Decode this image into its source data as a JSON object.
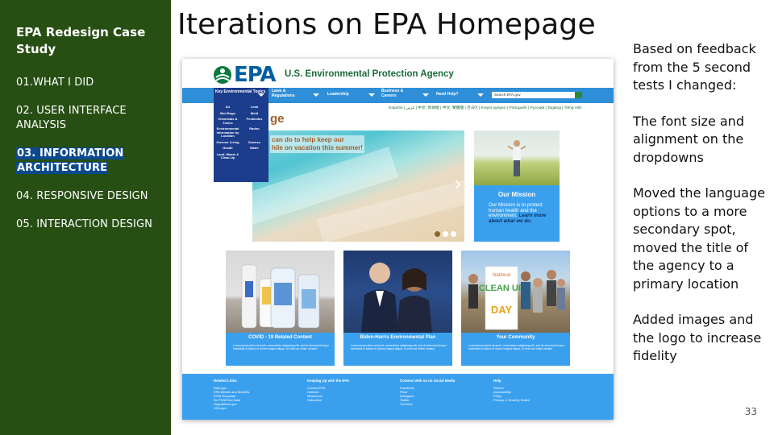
{
  "sidebar": {
    "title": "EPA Redesign Case Study",
    "items": [
      {
        "label": "01.WHAT I DID"
      },
      {
        "label": "02. USER INTERFACE ANALYSIS"
      },
      {
        "label": "03. INFORMATION ARCHITECTURE"
      },
      {
        "label": "04. RESPONSIVE DESIGN"
      },
      {
        "label": "05. INTERACTION DESIGN"
      }
    ],
    "active_index": 2,
    "bg_color": "#274e13",
    "active_highlight": "#0b4a8e"
  },
  "slide": {
    "title": "Iterations on EPA Homepage",
    "page_number": "33"
  },
  "notes": [
    "Based on feedback from the 5 second tests I changed:",
    "The font size and alignment on the dropdowns",
    "Moved the language options to a more secondary spot, moved the title of the agency to a primary location",
    "Added images and the logo to increase fidelity"
  ],
  "mockup": {
    "logo_text": "EPA",
    "agency_name": "U.S. Environmental Protection Agency",
    "nav": [
      {
        "label": "Key Environmental Topics"
      },
      {
        "label": "Laws & Regulations"
      },
      {
        "label": "Leadership"
      },
      {
        "label": "Business & Careers"
      },
      {
        "label": "Need Help?"
      }
    ],
    "search_placeholder": "Search EPA.gov",
    "languages": "Español | عربي | 中文: 简体版 | 中文: 繁體版 | 한국어 | Kreyòl ayisyen | Português | Русский | Tagalog | Tiếng Việt",
    "dropdown_items": [
      "Air",
      "Lead",
      "Bed Bugs",
      "Mold",
      "Chemicals & Toxics",
      "Pesticides",
      "Environmental Information by Location",
      "Radon",
      "Greener Living",
      "Science",
      "Health",
      "Water",
      "Land, Waste & Clean-Up",
      ""
    ],
    "page_heading": "ge",
    "hero_text_line1": "can do to help keep our",
    "hero_text_line2": "hile on vacation this summer!",
    "mission_title": "Our Mission",
    "mission_body": "Our Mission is to protect human health and the environment.",
    "mission_link": "Learn more about what we do.",
    "cards": [
      {
        "title": "COVID - 19 Related Content",
        "body": "Lorem ipsum dolor sit amet, consectetur adipiscing elit, sed do eiusmod tempor incididunt ut labore et dolore magna aliqua. Ut enim ad minim veniam."
      },
      {
        "title": "Biden-Harris Environmental Plan",
        "body": "Lorem ipsum dolor sit amet, consectetur adipiscing elit, sed do eiusmod tempor incididunt ut labore et dolore magna aliqua. Ut enim ad minim veniam."
      },
      {
        "title": "Your Community",
        "body": "Lorem ipsum dolor sit amet, consectetur adipiscing elit, sed do eiusmod tempor incididunt ut labore et dolore magna aliqua. Ut enim ad minim veniam."
      }
    ],
    "clean_sign": {
      "line1": "National",
      "line2": "CLEAN UP",
      "line3": "DAY"
    },
    "footer": [
      {
        "heading": "Related Links",
        "links": "Data.gov\nEPA Wealth and Benefits\nFOIA Requests\nNo FEAR Act Data\nRegulations.gov\nUSA.gov"
      },
      {
        "heading": "Keeping Up with the EPA",
        "links": "Contact EPA\nHotlines\nNewsroom\nSubscribe"
      },
      {
        "heading": "Connect with us on Social Media",
        "links": "Facebook\nFlickr\nInstagram\nTwitter\nYouTube"
      },
      {
        "heading": "Help",
        "links": "Search\nAccessibility\nFAQs\nPrivacy & Security Notice"
      }
    ],
    "accent_blue": "#3aa0ee",
    "nav_blue": "#2e8ed8",
    "dropdown_navy": "#1c3c8c"
  }
}
